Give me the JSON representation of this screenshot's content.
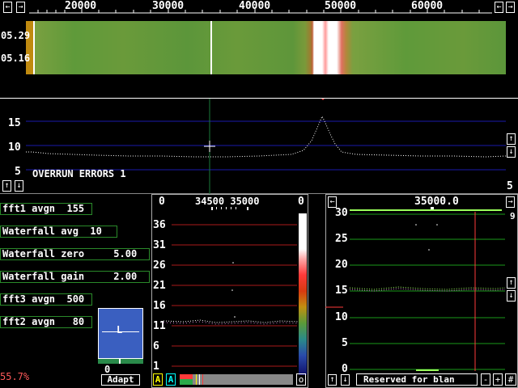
{
  "top_scale": {
    "ticks": [
      "20000",
      "30000",
      "40000",
      "50000",
      "60000"
    ]
  },
  "waterfall": {
    "time_labels": [
      "05.29",
      "05.16"
    ]
  },
  "spectrum": {
    "y_labels": [
      "15",
      "10",
      "5"
    ],
    "message": "OVERRUN ERRORS 1",
    "corner_value": "5"
  },
  "params": {
    "fft1_avgn": "fft1 avgn  155",
    "wf_avg": "Waterfall avg  10",
    "wf_zero": "Waterfall zero     5.00",
    "wf_gain": "Waterfall gain     2.00",
    "fft3_avgn": "fft3 avgn  500",
    "fft2_avgn": "fft2 avgn   80"
  },
  "status": {
    "percent": "55.7%"
  },
  "smeter": {
    "label": "L",
    "value": "0",
    "adapt_label": "Adapt"
  },
  "middle_panel": {
    "left_corner": "0",
    "right_corner": "0",
    "freq_label": "34500 35000",
    "y_labels": [
      "36",
      "31",
      "26",
      "21",
      "16",
      "11",
      "6",
      "1"
    ],
    "btn_a1": "A",
    "btn_a2": "A",
    "btn_o": "o"
  },
  "right_panel": {
    "freq_label": "35000.0",
    "corner_value": "9",
    "y_labels": [
      "30",
      "25",
      "20",
      "15",
      "10",
      "5",
      "0"
    ],
    "footer_text": "Reserved for blan",
    "minus_label": "-",
    "plus_label": "+",
    "hash_label": "#"
  },
  "colors": {
    "grid_blue": "#1a1aaa",
    "grid_red": "#aa1a1a",
    "grid_green": "#1a9a1a",
    "waterfall_green": "#6a9a3a",
    "percent_red": "#ff5a5a"
  }
}
